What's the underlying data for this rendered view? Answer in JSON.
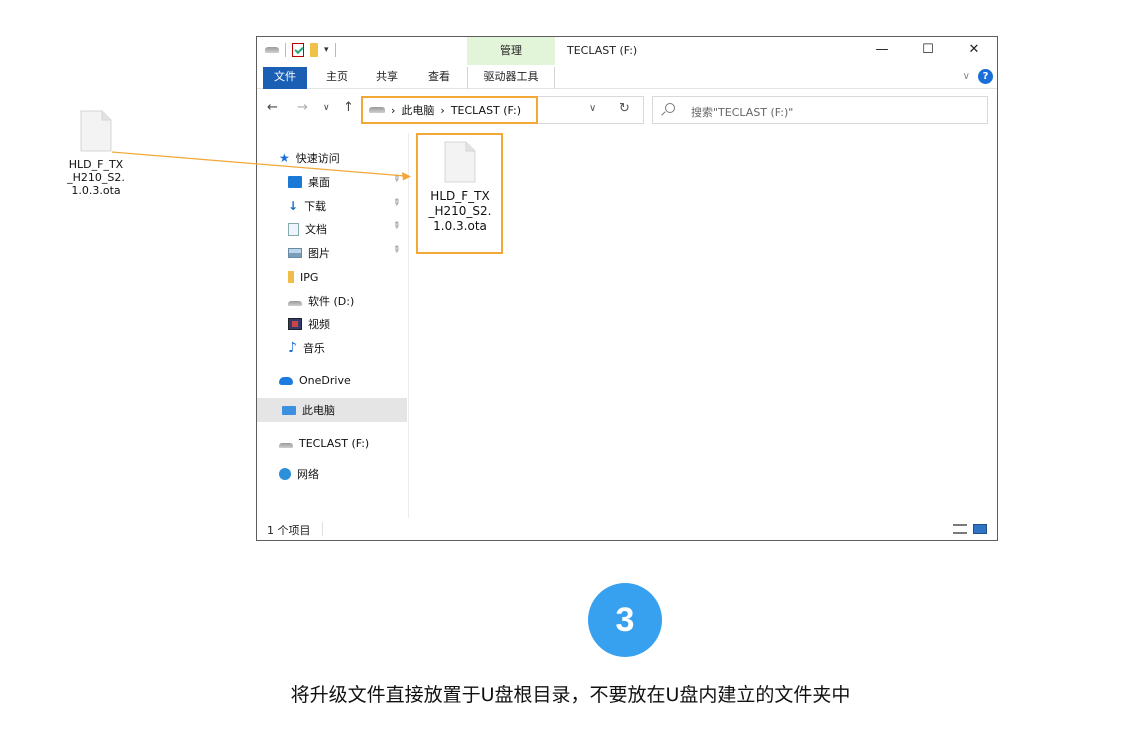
{
  "desktop_file": {
    "name_lines": [
      "HLD_F_TX",
      "_H210_S2.",
      "1.0.3.ota"
    ]
  },
  "window": {
    "title": "TECLAST (F:)",
    "manage_tab": "管理",
    "controls": {
      "minimize": "—",
      "maximize": "☐",
      "close": "✕"
    },
    "ribbon_tabs": [
      "文件",
      "主页",
      "共享",
      "查看",
      "驱动器工具"
    ],
    "ribbon_expand": "∨",
    "help": "?",
    "address": {
      "back": "←",
      "forward": "→",
      "recent": "∨",
      "up": "↑",
      "crumb_sep1": "›",
      "crumb_pc": "此电脑",
      "crumb_sep2": "›",
      "crumb_drive": "TECLAST (F:)",
      "dropdown": "∨",
      "refresh": "↻"
    },
    "search_placeholder": "搜索\"TECLAST (F:)\"",
    "nav": {
      "quick_access": "快速访问",
      "items": [
        "桌面",
        "下载",
        "文档",
        "图片",
        "IPG",
        "软件 (D:)",
        "视频",
        "音乐"
      ],
      "onedrive": "OneDrive",
      "this_pc": "此电脑",
      "teclast": "TECLAST (F:)",
      "network": "网络",
      "pin": "📌"
    },
    "content_file": {
      "name_lines": [
        "HLD_F_TX",
        "_H210_S2.",
        "1.0.3.ota"
      ]
    },
    "status": "1 个项目"
  },
  "step": {
    "number": "3",
    "caption": "将升级文件直接放置于U盘根目录，不要放在U盘内建立的文件夹中"
  },
  "colors": {
    "highlight": "#f2a737",
    "badge": "#37a1ef",
    "accent": "#1a5fb4"
  }
}
